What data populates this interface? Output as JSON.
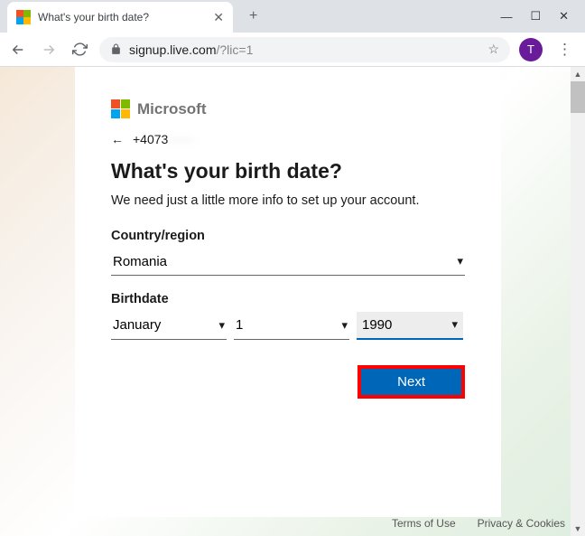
{
  "browser": {
    "tab_title": "What's your birth date?",
    "url_host": "signup.live.com",
    "url_path": "/?lic=1",
    "avatar_letter": "T"
  },
  "ms": {
    "brand": "Microsoft"
  },
  "back": {
    "phone_prefix": "+4073",
    "phone_hidden": "······"
  },
  "page": {
    "heading": "What's your birth date?",
    "subtext": "We need just a little more info to set up your account."
  },
  "country": {
    "label": "Country/region",
    "value": "Romania"
  },
  "birth": {
    "label": "Birthdate",
    "month": "January",
    "day": "1",
    "year": "1990"
  },
  "actions": {
    "next": "Next"
  },
  "footer": {
    "terms": "Terms of Use",
    "privacy": "Privacy & Cookies"
  }
}
